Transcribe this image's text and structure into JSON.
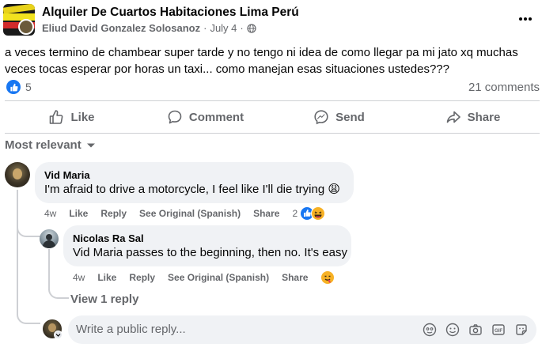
{
  "post": {
    "group_name": "Alquiler De Cuartos Habitaciones Lima Perú",
    "author": "Eliud David Gonzalez Solosanoz",
    "separator": "·",
    "date": "July 4",
    "date_separator": "·",
    "text": "a veces termino de chambear super tarde y no tengo ni idea de como llegar pa mi jato xq muchas veces tocas esperar por horas un taxi... como manejan esas situaciones ustedes???",
    "reaction_count": "5",
    "comments_count": "21 comments"
  },
  "actions": {
    "like": "Like",
    "comment": "Comment",
    "send": "Send",
    "share": "Share"
  },
  "sort": {
    "label": "Most relevant"
  },
  "comments": [
    {
      "author": "Vid Maria",
      "text": "I'm afraid to drive a motorcycle, I feel like I'll die trying 😩",
      "time": "4w",
      "like": "Like",
      "reply": "Reply",
      "see_original": "See Original (Spanish)",
      "share": "Share",
      "reaction_count": "2"
    },
    {
      "author": "Nicolas Ra Sal",
      "text": "Vid Maria passes to the beginning, then no. It's easy",
      "time": "4w",
      "like": "Like",
      "reply": "Reply",
      "see_original": "See Original (Spanish)",
      "share": "Share"
    }
  ],
  "view_replies": "View 1 reply",
  "reply_box": {
    "placeholder": "Write a public reply..."
  },
  "colors": {
    "brand_blue": "#1877f2",
    "muted_text": "#65676b",
    "bubble_bg": "#f0f2f5",
    "divider": "#ced0d4"
  },
  "icons": [
    "more-horizontal-icon",
    "globe-icon",
    "like-reaction-icon",
    "thumb-up-icon",
    "comment-icon",
    "messenger-icon",
    "share-arrow-icon",
    "chevron-down-icon",
    "haha-reaction-icon",
    "sticker-icon",
    "emoji-icon",
    "camera-icon",
    "gif-icon",
    "avatar-sticker-icon"
  ]
}
